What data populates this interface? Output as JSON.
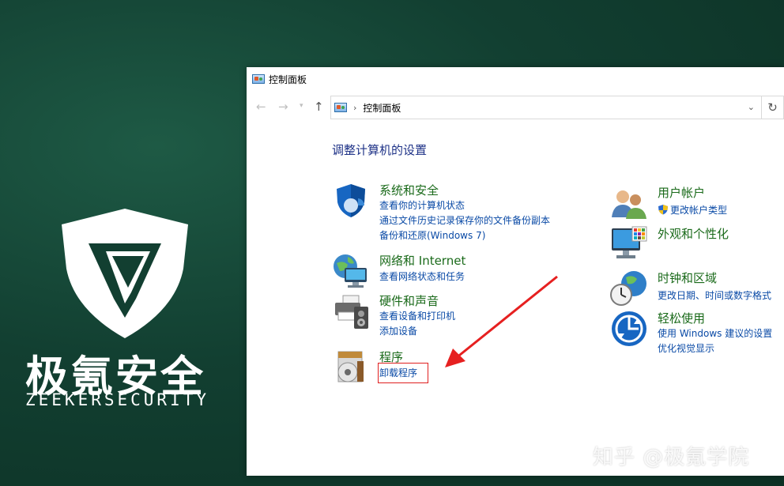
{
  "brand": {
    "name_cn": "极氪安全",
    "name_en": "ZEEKERSECURITY"
  },
  "window": {
    "title": "控制面板",
    "address": "控制面板",
    "heading": "调整计算机的设置"
  },
  "categories": {
    "system_security": {
      "title": "系统和安全",
      "links": [
        "查看你的计算机状态",
        "通过文件历史记录保存你的文件备份副本",
        "备份和还原(Windows 7)"
      ]
    },
    "network": {
      "title": "网络和 Internet",
      "links": [
        "查看网络状态和任务"
      ]
    },
    "hardware": {
      "title": "硬件和声音",
      "links": [
        "查看设备和打印机",
        "添加设备"
      ]
    },
    "programs": {
      "title": "程序",
      "links": [
        "卸载程序"
      ]
    },
    "user_accounts": {
      "title": "用户帐户",
      "links": [
        "更改帐户类型"
      ]
    },
    "appearance": {
      "title": "外观和个性化",
      "links": []
    },
    "clock_region": {
      "title": "时钟和区域",
      "links": [
        "更改日期、时间或数字格式"
      ]
    },
    "ease_of_access": {
      "title": "轻松使用",
      "links": [
        "使用 Windows 建议的设置",
        "优化视觉显示"
      ]
    }
  },
  "watermark": "知乎 @极氪学院",
  "colors": {
    "background": "#123f31",
    "category_title": "#1a6a1a",
    "link": "#0a4aa6",
    "heading": "#1e3287",
    "highlight": "#e02020"
  }
}
